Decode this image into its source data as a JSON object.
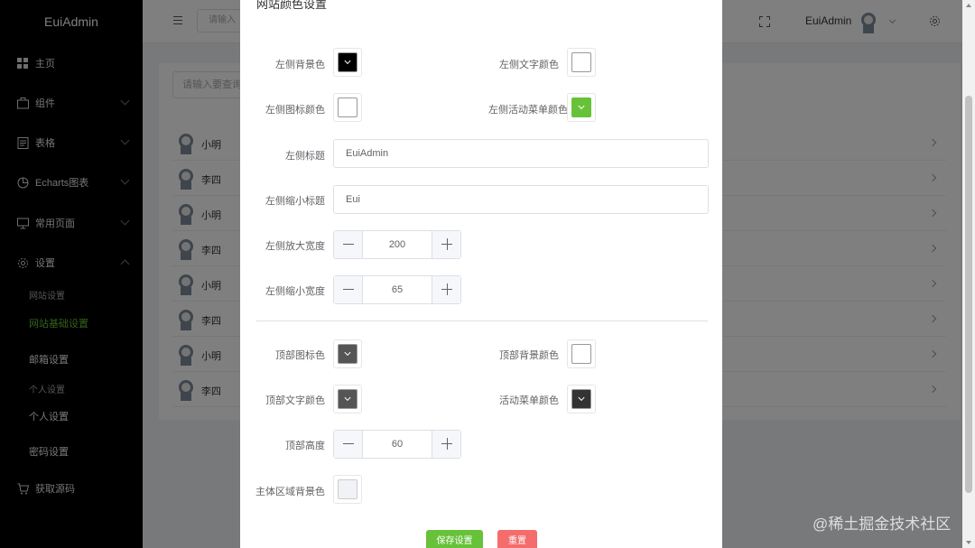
{
  "sidebar": {
    "brand": "EuiAdmin",
    "items": [
      {
        "label": "主页"
      },
      {
        "label": "组件"
      },
      {
        "label": "表格"
      },
      {
        "label": "Echarts图表"
      },
      {
        "label": "常用页面"
      },
      {
        "label": "设置"
      },
      {
        "label": "获取源码"
      }
    ],
    "sub": {
      "site_settings": "网站设置",
      "site_basic_settings": "网站基础设置",
      "mail_settings": "邮箱设置",
      "personal_group": "个人设置",
      "personal_settings": "个人设置",
      "password_settings": "密码设置"
    }
  },
  "header": {
    "search_placeholder": "请输入",
    "user_name": "EuiAdmin"
  },
  "content": {
    "search_placeholder": "请输入要查询",
    "rows": [
      {
        "name": "小明"
      },
      {
        "name": "李四"
      },
      {
        "name": "小明"
      },
      {
        "name": "李四"
      },
      {
        "name": "小明"
      },
      {
        "name": "李四"
      },
      {
        "name": "小明"
      },
      {
        "name": "李四"
      }
    ]
  },
  "dialog": {
    "title": "网站颜色设置",
    "fields": {
      "left_bg_color": {
        "label": "左侧背景色",
        "color": "#000000"
      },
      "left_text_color": {
        "label": "左侧文字颜色",
        "color": "#ffffff"
      },
      "left_icon_color": {
        "label": "左侧图标颜色",
        "color": "#ffffff"
      },
      "left_active_menu_color": {
        "label": "左侧活动菜单颜色",
        "color": "#67c23a"
      },
      "left_title": {
        "label": "左侧标题",
        "value": "EuiAdmin"
      },
      "left_mini_title": {
        "label": "左侧缩小标题",
        "value": "Eui"
      },
      "left_expanded_width": {
        "label": "左侧放大宽度",
        "value": "200"
      },
      "left_collapsed_width": {
        "label": "左侧缩小宽度",
        "value": "65"
      },
      "top_icon_color": {
        "label": "顶部图标色",
        "color": "#555555"
      },
      "top_bg_color": {
        "label": "顶部背景颜色",
        "color": "#ffffff"
      },
      "top_text_color": {
        "label": "顶部文字颜色",
        "color": "#555555"
      },
      "active_menu_color": {
        "label": "活动菜单颜色",
        "color": "#333333"
      },
      "top_height": {
        "label": "顶部高度",
        "value": "60"
      },
      "main_bg_color": {
        "label": "主体区域背景色",
        "color": "#f0f2f5"
      }
    },
    "save_label": "保存设置",
    "reset_label": "重置"
  },
  "watermark": "@稀土掘金技术社区",
  "colors": {
    "accent_green": "#67c23a",
    "danger_red": "#f56c6c"
  }
}
